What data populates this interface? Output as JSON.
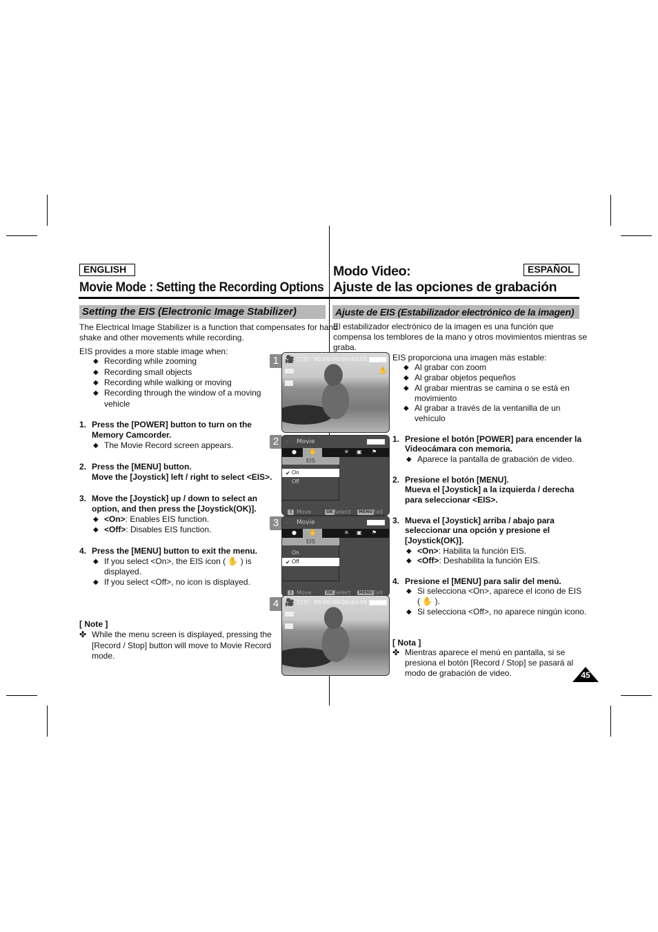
{
  "english": {
    "lang_label": "ENGLISH",
    "title": "Movie Mode : Setting the Recording Options",
    "section": "Setting the EIS (Electronic Image Stabilizer)",
    "intro": [
      "The Electrical Image Stabilizer is a function that compensates for hand",
      "shake and other movements while recording."
    ],
    "provides": "EIS provides a more stable image when:",
    "conditions": [
      "Recording while zooming",
      "Recording small objects",
      "Recording while walking or moving",
      "Recording through the  window of a moving",
      "vehicle"
    ],
    "steps": [
      {
        "num": "1.",
        "lines": [
          "Press the [POWER] button to turn on the",
          "Memory Camcorder."
        ],
        "bullets": [
          "The Movie Record screen appears."
        ]
      },
      {
        "num": "2.",
        "lines": [
          "Press the [MENU] button.",
          "Move the [Joystick] left / right to select <EIS>."
        ],
        "bullets": []
      },
      {
        "num": "3.",
        "lines": [
          "Move the [Joystick] up / down to select an",
          "option, and then press the [Joystick(OK)]."
        ],
        "bullets": [
          {
            "key": "<On>",
            "text": ": Enables EIS function."
          },
          {
            "key": "<Off>",
            "text": ": Disables EIS function."
          }
        ]
      },
      {
        "num": "4.",
        "lines": [
          "Press the [MENU] button to exit the menu."
        ],
        "bullets": [
          "If you select <On>, the EIS icon ( ✋ ) is",
          "displayed.",
          "If you select <Off>, no icon is displayed."
        ]
      }
    ],
    "note_title": "[ Note ]",
    "note": [
      "While the menu screen is displayed, pressing the",
      "[Record / Stop] button will move to Movie Record",
      "mode."
    ]
  },
  "spanish": {
    "lang_label": "ESPAÑOL",
    "title_line1": "Modo Video:",
    "title_line2": "Ajuste de las opciones de grabación",
    "section": "Ajuste de EIS (Estabilizador electrónico de la imagen)",
    "intro": [
      "El estabilizador electrónico de la imagen es una función que",
      "compensa los temblores de la mano y otros movimientos mientras se",
      "graba."
    ],
    "provides": "EIS proporciona una imagen más estable:",
    "conditions": [
      "Al grabar con zoom",
      "Al grabar objetos pequeños",
      "Al grabar mientras se camina o se está en",
      "movimiento",
      "Al grabar a través de la ventanilla de un",
      "vehículo"
    ],
    "steps": [
      {
        "num": "1.",
        "lines": [
          "Presione el botón [POWER] para encender la",
          "Videocámara con memoria."
        ],
        "bullets": [
          "Aparece la pantalla de grabación de video."
        ]
      },
      {
        "num": "2.",
        "lines": [
          "Presione el botón [MENU].",
          "Mueva el [Joystick] a la izquierda / derecha",
          "para seleccionar <EIS>."
        ],
        "bullets": []
      },
      {
        "num": "3.",
        "lines": [
          "Mueva el [Joystick] arriba / abajo para",
          "seleccionar una opción y presione el",
          "[Joystick(OK)]."
        ],
        "bullets": [
          {
            "key": "<On>",
            "text": ": Habilita la función EIS."
          },
          {
            "key": "<Off>",
            "text": ": Deshabilita la función EIS."
          }
        ]
      },
      {
        "num": "4.",
        "lines": [
          "Presione el [MENU] para salir del menú."
        ],
        "bullets": [
          "Si selecciona <On>, aparece el icono de EIS",
          "( ✋ ).",
          "Si selecciona <Off>, no aparece ningún icono."
        ]
      }
    ],
    "note_title": "[ Nota ]",
    "note": [
      "Mientras aparece el menú en pantalla, si se",
      "presiona el botón [Record / Stop] se pasará al",
      "modo de grabación de video."
    ]
  },
  "screens": [
    {
      "step": "1",
      "type": "record",
      "status": "STBY",
      "timecode": "00:00:00/00:40:05",
      "eis_icon": true
    },
    {
      "step": "2",
      "type": "menu",
      "mode": "Movie",
      "menu_item": "EIS",
      "options": [
        "On",
        "Off"
      ],
      "selected": "On",
      "footer": {
        "move": "Move",
        "select": "Select",
        "exit": "Exit",
        "ok_key": "OK",
        "menu_key": "MENU"
      }
    },
    {
      "step": "3",
      "type": "menu",
      "mode": "Movie",
      "menu_item": "EIS",
      "options": [
        "On",
        "Off"
      ],
      "selected": "Off",
      "footer": {
        "move": "Move",
        "select": "Select",
        "exit": "Exit",
        "ok_key": "OK",
        "menu_key": "MENU"
      }
    },
    {
      "step": "4",
      "type": "record",
      "status": "STBY",
      "timecode": "00:00:00/00:40:05",
      "eis_icon": false
    }
  ],
  "page_number": "45",
  "icons": {
    "bullet": "◆",
    "note": "✤",
    "check": "✔"
  }
}
